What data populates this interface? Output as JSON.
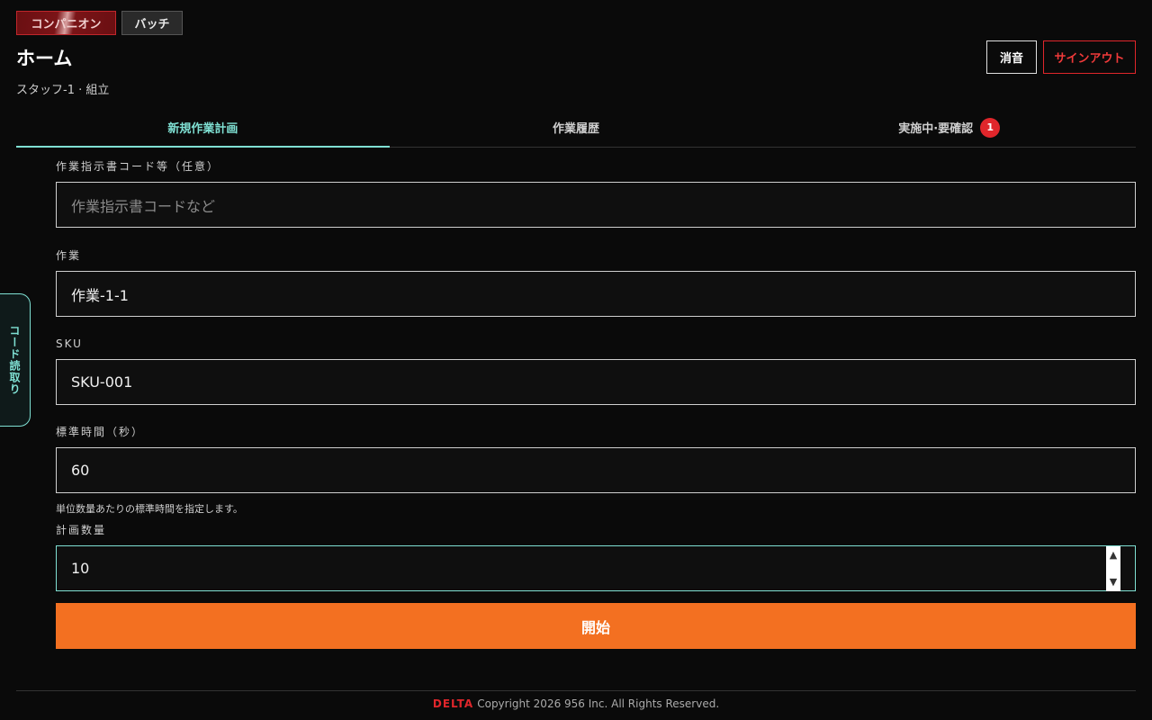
{
  "mode_switch": {
    "companion": "コンパニオン",
    "batch": "バッチ"
  },
  "header": {
    "title": "ホーム",
    "subtitle": "スタッフ-1 · 組立",
    "mute_label": "消音",
    "signout_label": "サインアウト"
  },
  "tabs": [
    {
      "label": "新規作業計画",
      "active": true
    },
    {
      "label": "作業履歴"
    },
    {
      "label": "実施中·要確認",
      "badge": "1"
    }
  ],
  "side_tab": {
    "label": "コード読取り"
  },
  "form": {
    "order_code": {
      "label": "作業指示書コード等（任意）",
      "placeholder": "作業指示書コードなど",
      "value": ""
    },
    "task": {
      "label": "作業",
      "value": "作業-1-1"
    },
    "sku": {
      "label": "SKU",
      "value": "SKU-001"
    },
    "std_time": {
      "label": "標準時間（秒）",
      "value": "60",
      "hint": "単位数量あたりの標準時間を指定します。"
    },
    "plan_qty": {
      "label": "計画数量",
      "value": "10"
    },
    "start_label": "開始"
  },
  "footer": {
    "brand": "DELTA",
    "copyright": "Copyright 2026 956 Inc. All Rights Reserved."
  },
  "colors": {
    "accent": "#7fe0d3",
    "danger": "#e0262b",
    "primary": "#f37021"
  }
}
